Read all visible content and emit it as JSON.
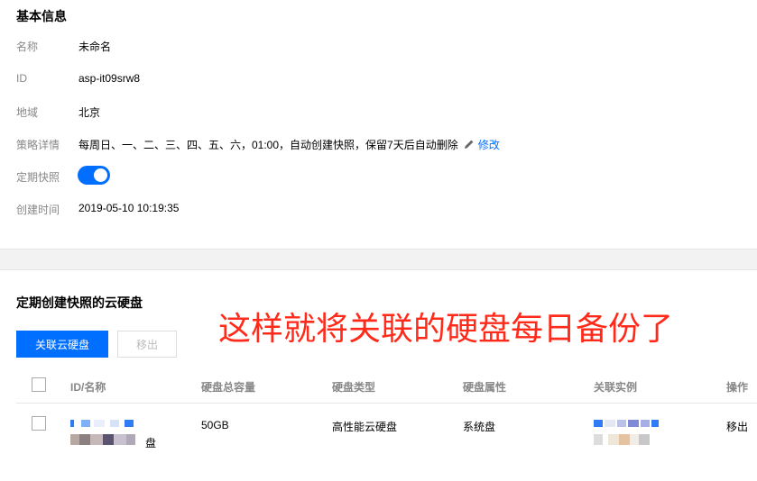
{
  "basic_info": {
    "title": "基本信息",
    "name_label": "名称",
    "name_value": "未命名",
    "id_label": "ID",
    "id_value": "asp-it09srw8",
    "region_label": "地域",
    "region_value": "北京",
    "policy_label": "策略详情",
    "policy_value": "每周日、一、二、三、四、五、六，01:00，自动创建快照，保留7天后自动删除",
    "policy_edit": "修改",
    "snapshot_label": "定期快照",
    "snapshot_enabled": true,
    "created_label": "创建时间",
    "created_value": "2019-05-10 10:19:35"
  },
  "disks_section": {
    "title": "定期创建快照的云硬盘",
    "annotation": "这样就将关联的硬盘每日备份了",
    "associate_button": "关联云硬盘",
    "remove_button": "移出",
    "columns": [
      "ID/名称",
      "硬盘总容量",
      "硬盘类型",
      "硬盘属性",
      "关联实例",
      "操作"
    ],
    "rows": [
      {
        "name_suffix": "盘",
        "capacity": "50GB",
        "type": "高性能云硬盘",
        "attribute": "系统盘",
        "action": "移出"
      }
    ]
  },
  "colors": {
    "accent": "#006eff",
    "annotation": "#ff2a1a"
  }
}
